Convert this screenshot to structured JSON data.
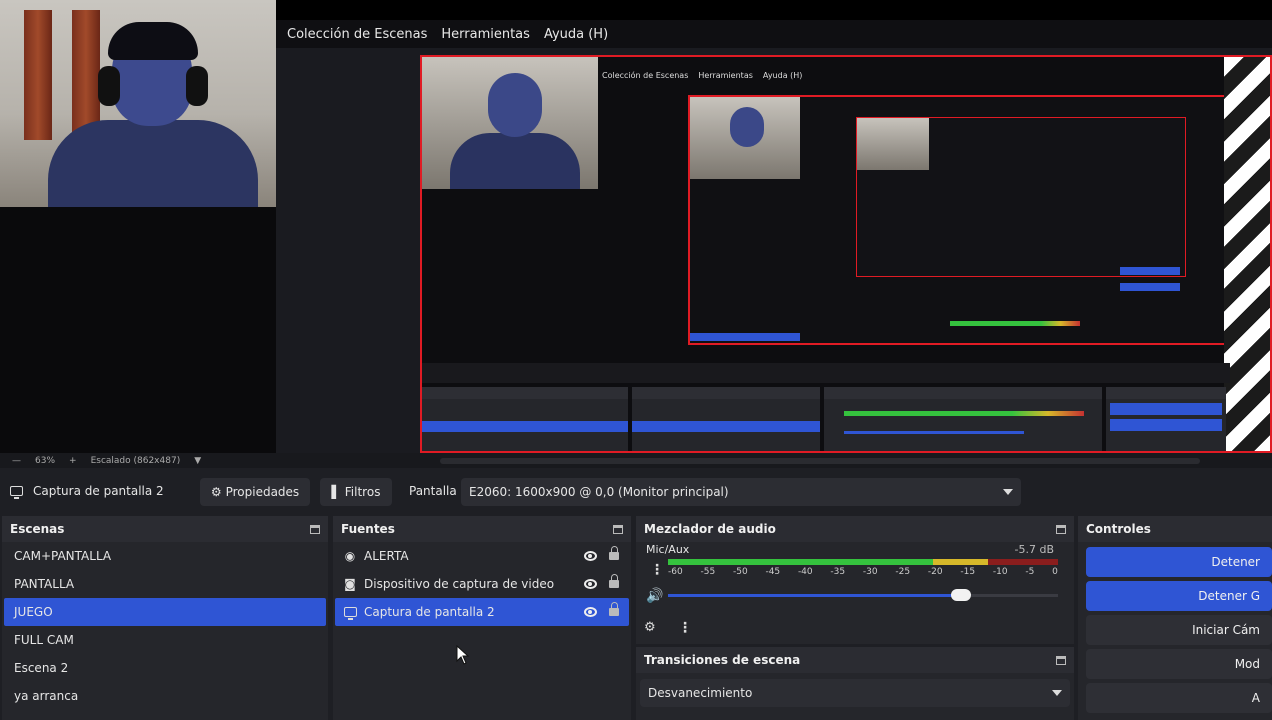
{
  "menu": {
    "items": [
      "Colección de Escenas",
      "Herramientas",
      "Ayuda (H)"
    ]
  },
  "preview": {
    "zoom": "63%",
    "scale_label": "Escalado (862x487)",
    "mini_menu": [
      "Colección de Escenas",
      "Herramientas",
      "Ayuda (H)"
    ]
  },
  "source_toolbar": {
    "source_name": "Captura de pantalla 2",
    "properties_label": "Propiedades",
    "filters_label": "Filtros",
    "display_label": "Pantalla",
    "display_value": "E2060: 1600x900 @ 0,0 (Monitor principal)"
  },
  "scenes": {
    "title": "Escenas",
    "items": [
      "CAM+PANTALLA",
      "PANTALLA",
      "JUEGO",
      "FULL CAM",
      "Escena 2",
      "ya arranca"
    ],
    "selected_index": 2
  },
  "sources": {
    "title": "Fuentes",
    "items": [
      {
        "label": "ALERTA",
        "icon": "globe-icon"
      },
      {
        "label": "Dispositivo de captura de video",
        "icon": "camera-icon"
      },
      {
        "label": "Captura de pantalla 2",
        "icon": "monitor-icon"
      }
    ],
    "selected_index": 2
  },
  "mixer": {
    "title": "Mezclador de audio",
    "channel": "Mic/Aux",
    "db": "-5.7 dB",
    "ticks": [
      "-60",
      "-55",
      "-50",
      "-45",
      "-40",
      "-35",
      "-30",
      "-25",
      "-20",
      "-15",
      "-10",
      "-5",
      "0"
    ],
    "volume_level": 0.75
  },
  "transitions": {
    "title": "Transiciones de escena",
    "selected": "Desvanecimiento"
  },
  "controls": {
    "title": "Controles",
    "buttons": [
      "Detener",
      "Detener G",
      "Iniciar Cám",
      "Mod",
      "A"
    ]
  },
  "colors": {
    "accent": "#2f55d4",
    "preview_border": "#e01b24",
    "background": "#1e1f24"
  }
}
